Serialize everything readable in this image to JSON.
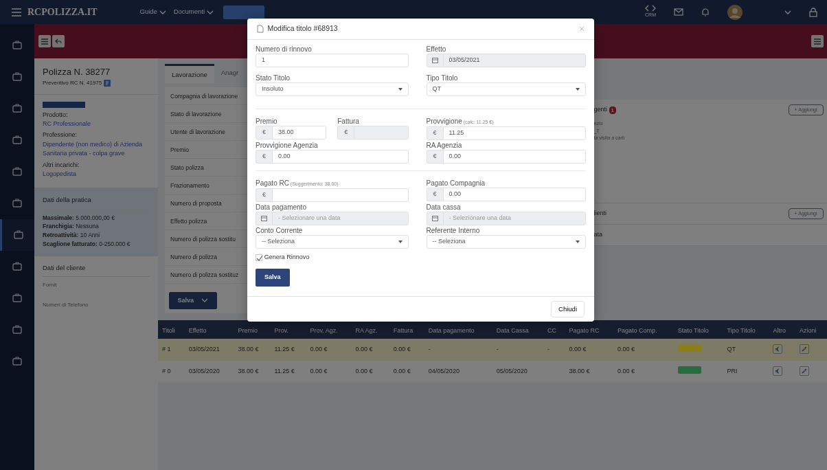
{
  "navbar": {
    "brand": "RCPOLIZZA.IT",
    "menus": [
      "Guide",
      "Documenti"
    ],
    "code_label": "CRM"
  },
  "sidebar": {
    "items": [
      {
        "selected": false
      },
      {
        "selected": false
      },
      {
        "selected": false
      },
      {
        "selected": false
      },
      {
        "selected": false
      },
      {
        "selected": false
      },
      {
        "selected": true
      },
      {
        "selected": false
      },
      {
        "selected": false
      },
      {
        "selected": false
      },
      {
        "selected": false
      }
    ]
  },
  "policy": {
    "title": "Polizza N. 38277",
    "quote": "Preventivo RC N. 41975",
    "fields": [
      {
        "label": "Prodotto:",
        "value": "RC Professionale"
      },
      {
        "label": "Professione:",
        "value": "Dipendente (non medico) di Azienda Sanitaria privata - colpa grave"
      },
      {
        "label": "Altri incarichi:",
        "value": "Logopedista"
      }
    ],
    "practice_title": "Dati della pratica",
    "practice": [
      {
        "label": "Massimale:",
        "value": "5.000.000,00 €"
      },
      {
        "label": "Franchigia:",
        "value": "Nessuna"
      },
      {
        "label": "Retroattività:",
        "value": "10 Anni"
      },
      {
        "label": "Scaglione fatturato:",
        "value": "0-250.000 €"
      }
    ],
    "client_title": "Dati del cliente",
    "client_labels": [
      "Fornit",
      "Numeri di Telefono"
    ]
  },
  "tabs": [
    {
      "label": "Lavorazione",
      "selected": true
    },
    {
      "label": "Anagr",
      "selected": false
    }
  ],
  "form_labels": [
    "Compagnia di lavorazione",
    "Stato di lavorazione",
    "Utente di lavorazione",
    "Premio",
    "Stato polizza",
    "Frazionamento",
    "Numero di proposta",
    "Effetto polizza",
    "Numero di polizza sostitu",
    "Numero di polizza",
    "Numero di polizza sostituz"
  ],
  "form_save": "Salva",
  "side_cards": [
    {
      "title": "genti",
      "badge": "1",
      "button": "+ Aggiungi",
      "lines": [
        "ezio",
        "_T",
        "ta visita a carti"
      ]
    },
    {
      "title": "lienti",
      "button": "+ Aggiungi"
    },
    {
      "title": "ata"
    }
  ],
  "table": {
    "columns": [
      "Titoli",
      "Effetto",
      "Premio",
      "Prov.",
      "Prov. Agz.",
      "RA Agz.",
      "Fattura",
      "Data pagamento",
      "Data Cassa",
      "CC",
      "Pagato RC",
      "Pagato Comp.",
      "Stato Titolo",
      "Tipo Titolo",
      "Altro",
      "Azioni"
    ],
    "rows": [
      {
        "selected": true,
        "color": "#8c7d1a",
        "cells": [
          "# 1",
          "03/05/2021",
          "38.00 €",
          "11.25 €",
          "0.00 €",
          "0.00 €",
          "0.00 €",
          "-",
          "-",
          "-",
          "0.00 €",
          "0.00 €",
          "",
          "QT"
        ]
      },
      {
        "selected": false,
        "color": "#2a6b3c",
        "cells": [
          "# 0",
          "03/05/2020",
          "38.00 €",
          "11.25 €",
          "0.00 €",
          "0.00 €",
          "0.00 €",
          "04/05/2020",
          "05/05/2020",
          "",
          "38.00 €",
          "0.00 €",
          "",
          "PRI"
        ]
      }
    ]
  },
  "modal": {
    "title": "Modifica titolo #68913",
    "sections": [
      [
        {
          "kind": "text",
          "label": "Numero di rinnovo",
          "value": "1"
        },
        {
          "kind": "date",
          "label": "Effetto",
          "value": "03/05/2021",
          "disabled": true
        },
        {
          "kind": "select",
          "label": "Stato Titolo",
          "value": "Insoluto"
        },
        {
          "kind": "select",
          "label": "Tipo Titolo",
          "value": "QT"
        }
      ],
      [
        {
          "kind": "pair",
          "fields": [
            {
              "kind": "money",
              "prefix": "€",
              "label": "Premio",
              "value": "38.00"
            },
            {
              "kind": "money",
              "prefix": "€",
              "label": "Fattura",
              "disabled": true
            }
          ]
        },
        {
          "kind": "money",
          "prefix": "€",
          "label": "Provvigione",
          "hint": "(calc: 11.25 €)",
          "value": "11.25"
        },
        {
          "kind": "money",
          "prefix": "€",
          "label": "Provvigione Agenzia",
          "value": "0.00"
        },
        {
          "kind": "money",
          "prefix": "€",
          "label": "RA Agenzia",
          "value": "0.00"
        }
      ],
      [
        {
          "kind": "money",
          "prefix": "€",
          "label": "Pagato RC",
          "hint": "(Suggerimento: 38.00)"
        },
        {
          "kind": "money",
          "prefix": "€",
          "label": "Pagato Compagnia",
          "value": "0.00"
        },
        {
          "kind": "date",
          "label": "Data pagamento",
          "placeholder": "- Selezionare una data",
          "disabled": true
        },
        {
          "kind": "date",
          "label": "Data cassa",
          "placeholder": "- Selezionare una data",
          "disabled": true
        },
        {
          "kind": "select",
          "label": "Conto Corrente",
          "value": "-- Seleziona"
        },
        {
          "kind": "select",
          "label": "Referente Interno",
          "value": "-- Seleziona"
        }
      ]
    ],
    "checkbox": {
      "label": "Genera Rinnovo",
      "checked": true
    },
    "save": "Salva",
    "close": "Chiudi"
  }
}
